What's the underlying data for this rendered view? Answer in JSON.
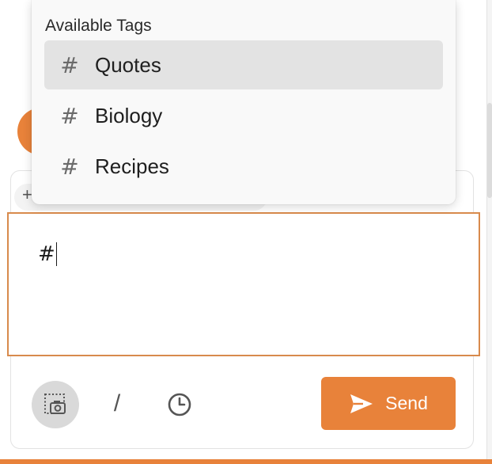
{
  "tags_popup": {
    "title": "Available Tags",
    "items": [
      {
        "icon": "hash-icon",
        "glyph": "#",
        "label": "Quotes",
        "selected": true
      },
      {
        "icon": "hash-icon",
        "glyph": "#",
        "label": "Biology",
        "selected": false
      },
      {
        "icon": "hash-icon",
        "glyph": "#",
        "label": "Recipes",
        "selected": false
      }
    ]
  },
  "composer": {
    "input_value": "#",
    "chip_plus": "+",
    "toolbar": {
      "photo_icon": "camera-selection-icon",
      "slash_label": "/",
      "clock_icon": "clock-icon",
      "send_label": "Send",
      "send_icon": "send-arrow-icon"
    }
  },
  "colors": {
    "accent": "#e8823a",
    "focus_ring": "#d88a4c",
    "selected_item": "#e3e3e3"
  }
}
